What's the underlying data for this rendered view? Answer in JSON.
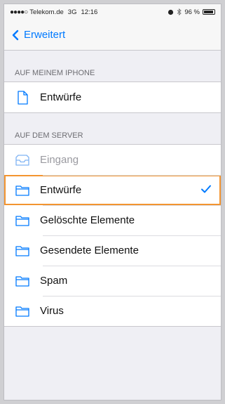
{
  "status_bar": {
    "signal": "●●●●○",
    "carrier": "Telekom.de",
    "network": "3G",
    "time": "12:16",
    "battery": "96 %"
  },
  "nav": {
    "back_label": "Erweitert"
  },
  "sections": {
    "phone": {
      "header": "AUF MEINEM IPHONE",
      "items": [
        {
          "label": "Entwürfe",
          "icon": "document-icon"
        }
      ]
    },
    "server": {
      "header": "AUF DEM SERVER",
      "items": [
        {
          "label": "Eingang",
          "icon": "inbox-icon",
          "disabled": true
        },
        {
          "label": "Entwürfe",
          "icon": "folder-icon",
          "selected": true
        },
        {
          "label": "Gelöschte Elemente",
          "icon": "folder-icon"
        },
        {
          "label": "Gesendete Elemente",
          "icon": "folder-icon"
        },
        {
          "label": "Spam",
          "icon": "folder-icon"
        },
        {
          "label": "Virus",
          "icon": "folder-icon"
        }
      ]
    }
  },
  "colors": {
    "accent": "#007aff",
    "highlight": "#f39530"
  }
}
